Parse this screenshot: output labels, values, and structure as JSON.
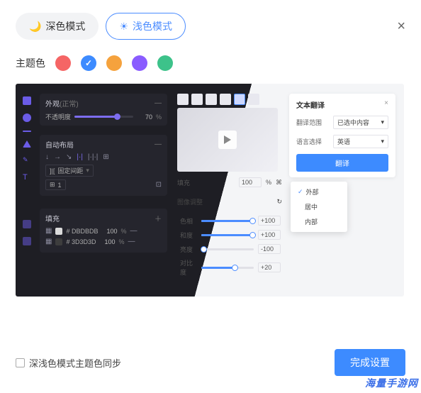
{
  "topbar": {
    "dark_mode": "深色模式",
    "light_mode": "浅色模式",
    "selected": "light"
  },
  "theme": {
    "label": "主题色",
    "colors": [
      {
        "hex": "#f56565"
      },
      {
        "hex": "#3d8bff",
        "selected": true
      },
      {
        "hex": "#f5a23d"
      },
      {
        "hex": "#8a5cff"
      },
      {
        "hex": "#3dc28a"
      }
    ]
  },
  "dark_panels": {
    "appearance": {
      "title": "外观",
      "subtitle_suffix": "(正常)",
      "opacity_label": "不透明度",
      "opacity_value": "70",
      "opacity_pct": "%"
    },
    "auto_layout": {
      "title": "自动布局",
      "gap_label": "固定间距",
      "count_box": "1"
    },
    "fill": {
      "title": "填充",
      "rows": [
        {
          "swatch": "#dbdbdb",
          "hex": "# DBDBDB",
          "val": "100",
          "pct": "%"
        },
        {
          "swatch": "#3d3d3d",
          "hex": "# 3D3D3D",
          "val": "100",
          "pct": "%"
        }
      ]
    }
  },
  "light_panels": {
    "fill": {
      "label": "填充",
      "val": "100",
      "pct": "%"
    },
    "image_adjust": {
      "label": "图像调整"
    },
    "sliders": [
      {
        "label": "色相",
        "val": "+100",
        "fill": 100
      },
      {
        "label": "和度",
        "val": "+100",
        "fill": 100
      },
      {
        "label": "亮度",
        "val": "-100",
        "fill": 0
      },
      {
        "label": "对比度",
        "val": "+20",
        "fill": 60
      }
    ]
  },
  "translate_card": {
    "title": "文本翻译",
    "scope_label": "翻译范围",
    "scope_value": "已选中内容",
    "lang_label": "语言选择",
    "lang_value": "英语",
    "action": "翻译"
  },
  "dropdown": {
    "items": [
      {
        "label": "外部",
        "selected": true
      },
      {
        "label": "居中"
      },
      {
        "label": "内部"
      }
    ]
  },
  "bottom": {
    "checkbox_label": "深浅色模式主题色同步",
    "done": "完成设置"
  },
  "watermark": "海量手游网"
}
